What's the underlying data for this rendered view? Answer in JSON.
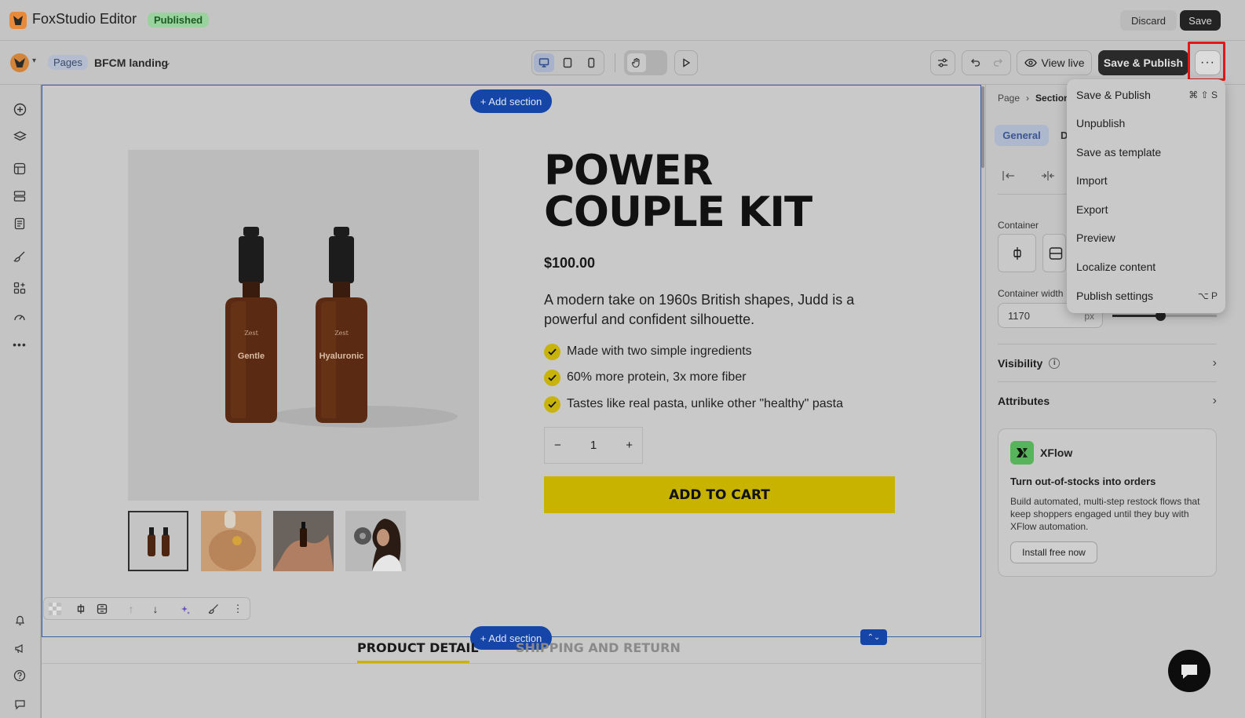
{
  "app": {
    "title": "FoxStudio Editor",
    "status_badge": "Published",
    "discard_label": "Discard",
    "save_label": "Save"
  },
  "toolbar": {
    "pages_chip": "Pages",
    "page_name": "BFCM landing",
    "view_live_label": "View live",
    "save_publish_label": "Save & Publish",
    "more_label": "···"
  },
  "canvas": {
    "add_section_label": "+ Add section",
    "product": {
      "title": "POWER COUPLE KIT",
      "price": "$100.00",
      "description": "A modern take on 1960s British shapes, Judd is a powerful and confident silhouette.",
      "features": [
        "Made with two simple ingredients",
        "60% more protein, 3x more fiber",
        "Tastes like real pasta, unlike other \"healthy\" pasta"
      ],
      "quantity": "1",
      "qty_minus": "−",
      "qty_plus": "+",
      "add_to_cart": "ADD TO CART",
      "bottle_labels": [
        "Gentle",
        "Hyaluronic"
      ],
      "bottle_brand": "Zest"
    },
    "tabs": [
      "PRODUCT DETAIL",
      "SHIPPING AND RETURN"
    ]
  },
  "panel": {
    "breadcrumb": [
      "Page",
      "Section"
    ],
    "tab_general": "General",
    "tab_other": "D",
    "container_label": "Container",
    "container_width_label": "Container width",
    "container_width_value": "1170",
    "container_width_unit": "px",
    "visibility_label": "Visibility",
    "attributes_label": "Attributes",
    "xflow": {
      "name": "XFlow",
      "headline": "Turn out-of-stocks into orders",
      "body": "Build automated, multi-step restock flows that keep shoppers engaged until they buy with XFlow automation.",
      "cta": "Install free now"
    }
  },
  "menu": {
    "items": [
      {
        "label": "Save & Publish",
        "shortcut": "⌘ ⇧ S"
      },
      {
        "label": "Unpublish",
        "shortcut": ""
      },
      {
        "label": "Save as template",
        "shortcut": ""
      },
      {
        "label": "Import",
        "shortcut": ""
      },
      {
        "label": "Export",
        "shortcut": ""
      },
      {
        "label": "Preview",
        "shortcut": ""
      },
      {
        "label": "Localize content",
        "shortcut": ""
      },
      {
        "label": "Publish settings",
        "shortcut": "⌥ P"
      }
    ]
  },
  "colors": {
    "accent_blue": "#1645a8",
    "cta_yellow": "#c8b400",
    "highlight_red": "#e01818",
    "published_green": "#9ad29e"
  }
}
